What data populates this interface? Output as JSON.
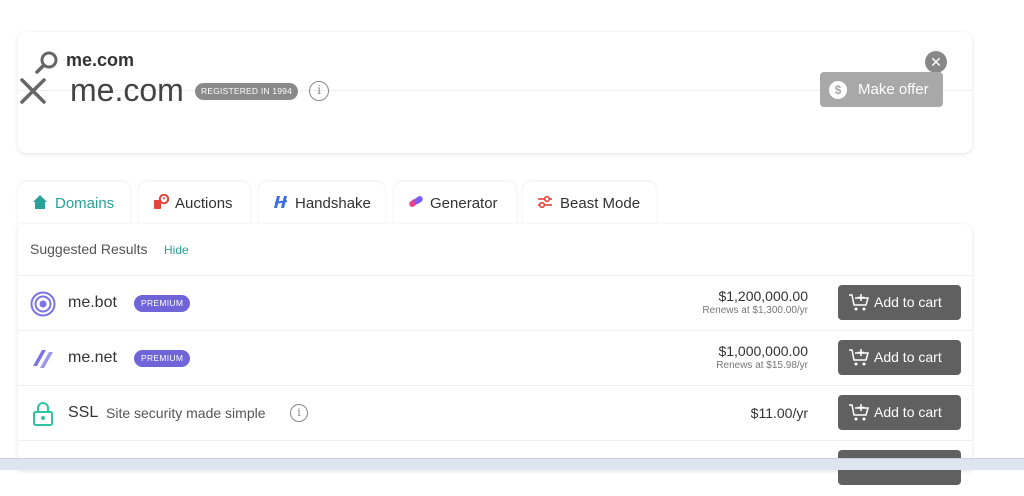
{
  "search": {
    "value": "me.com"
  },
  "lookup": {
    "domain": "me.com",
    "registered_badge": "REGISTERED IN 1994",
    "make_offer_label": "Make offer"
  },
  "tabs": [
    {
      "label": "Domains",
      "icon": "home-icon",
      "active": true
    },
    {
      "label": "Auctions",
      "icon": "auction-clock-icon"
    },
    {
      "label": "Handshake",
      "icon": "handshake-icon"
    },
    {
      "label": "Generator",
      "icon": "generator-icon"
    },
    {
      "label": "Beast Mode",
      "icon": "sliders-icon"
    }
  ],
  "suggested": {
    "title": "Suggested Results",
    "hide_label": "Hide"
  },
  "results": [
    {
      "name": "me.bot",
      "badge": "PREMIUM",
      "price": "$1,200,000.00",
      "renews": "Renews at $1,300.00/yr",
      "cart_label": "Add to cart",
      "icon": "bot-tld-icon"
    },
    {
      "name": "me.net",
      "badge": "PREMIUM",
      "price": "$1,000,000.00",
      "renews": "Renews at $15.98/yr",
      "cart_label": "Add to cart",
      "icon": "net-tld-icon"
    },
    {
      "name": "SSL",
      "description": "Site security made simple",
      "price": "$11.00/yr",
      "cart_label": "Add to cart",
      "icon": "lock-icon"
    }
  ],
  "colors": {
    "accent": "#2aa09a",
    "premium": "#6f64d8",
    "button_dark": "#606060",
    "button_disabled": "#a8a8a8"
  }
}
